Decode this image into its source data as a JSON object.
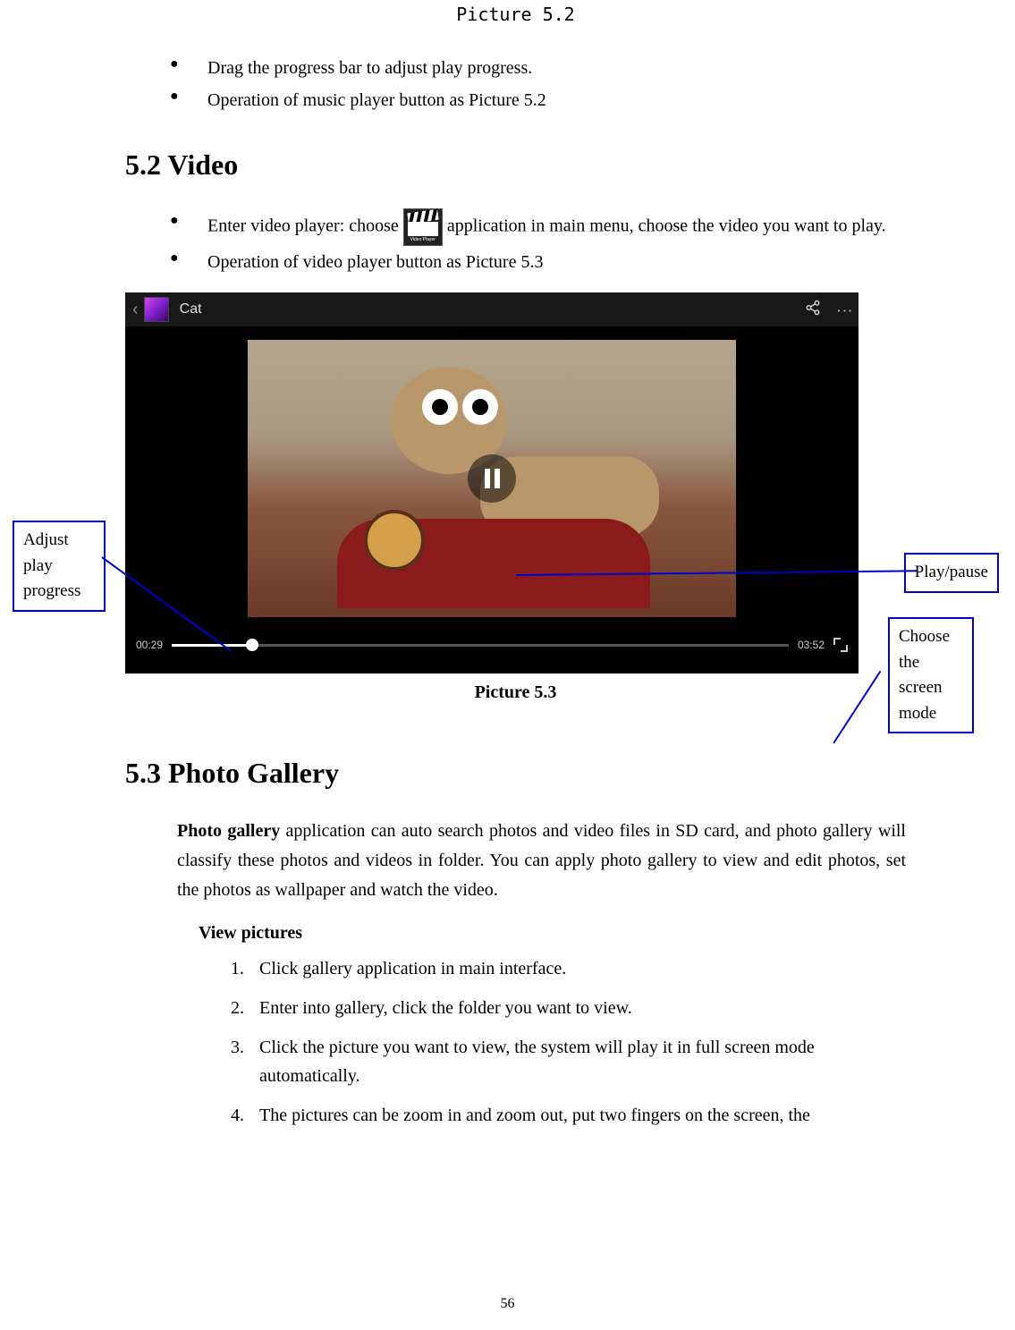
{
  "figure_label_top": "Picture 5.2",
  "intro_bullets": [
    "Drag the progress bar to adjust play progress.",
    "Operation of music player button as Picture 5.2"
  ],
  "section_52_heading": "5.2 Video",
  "video_bullets": {
    "b1_pre": "Enter video player: choose ",
    "b1_post": "application in main menu, choose the video you want to play.",
    "icon_label": "Video Player",
    "b2": "Operation of video player button as Picture 5.3"
  },
  "player": {
    "title": "Cat",
    "time_current": "00:29",
    "time_total": "03:52"
  },
  "callouts": {
    "adjust": "Adjust play progress",
    "playpause": "Play/pause",
    "screenmode": "Choose the screen mode"
  },
  "figure_label_53": "Picture 5.3",
  "section_53_heading": "5.3 Photo Gallery",
  "gallery_paragraph_strong": "Photo gallery",
  "gallery_paragraph_rest": " application can auto search photos and video files in SD card, and photo gallery will classify these photos and videos in folder. You can apply photo gallery to view and edit photos, set the photos as wallpaper and watch the video.",
  "view_pictures_heading": "View pictures",
  "view_steps": [
    "Click gallery application in main interface.",
    "Enter into gallery, click the folder you want to view.",
    "Click the picture you want to view, the system will play it in full screen mode automatically.",
    "The pictures can be zoom in and zoom out, put two fingers on the screen, the"
  ],
  "page_number": "56"
}
